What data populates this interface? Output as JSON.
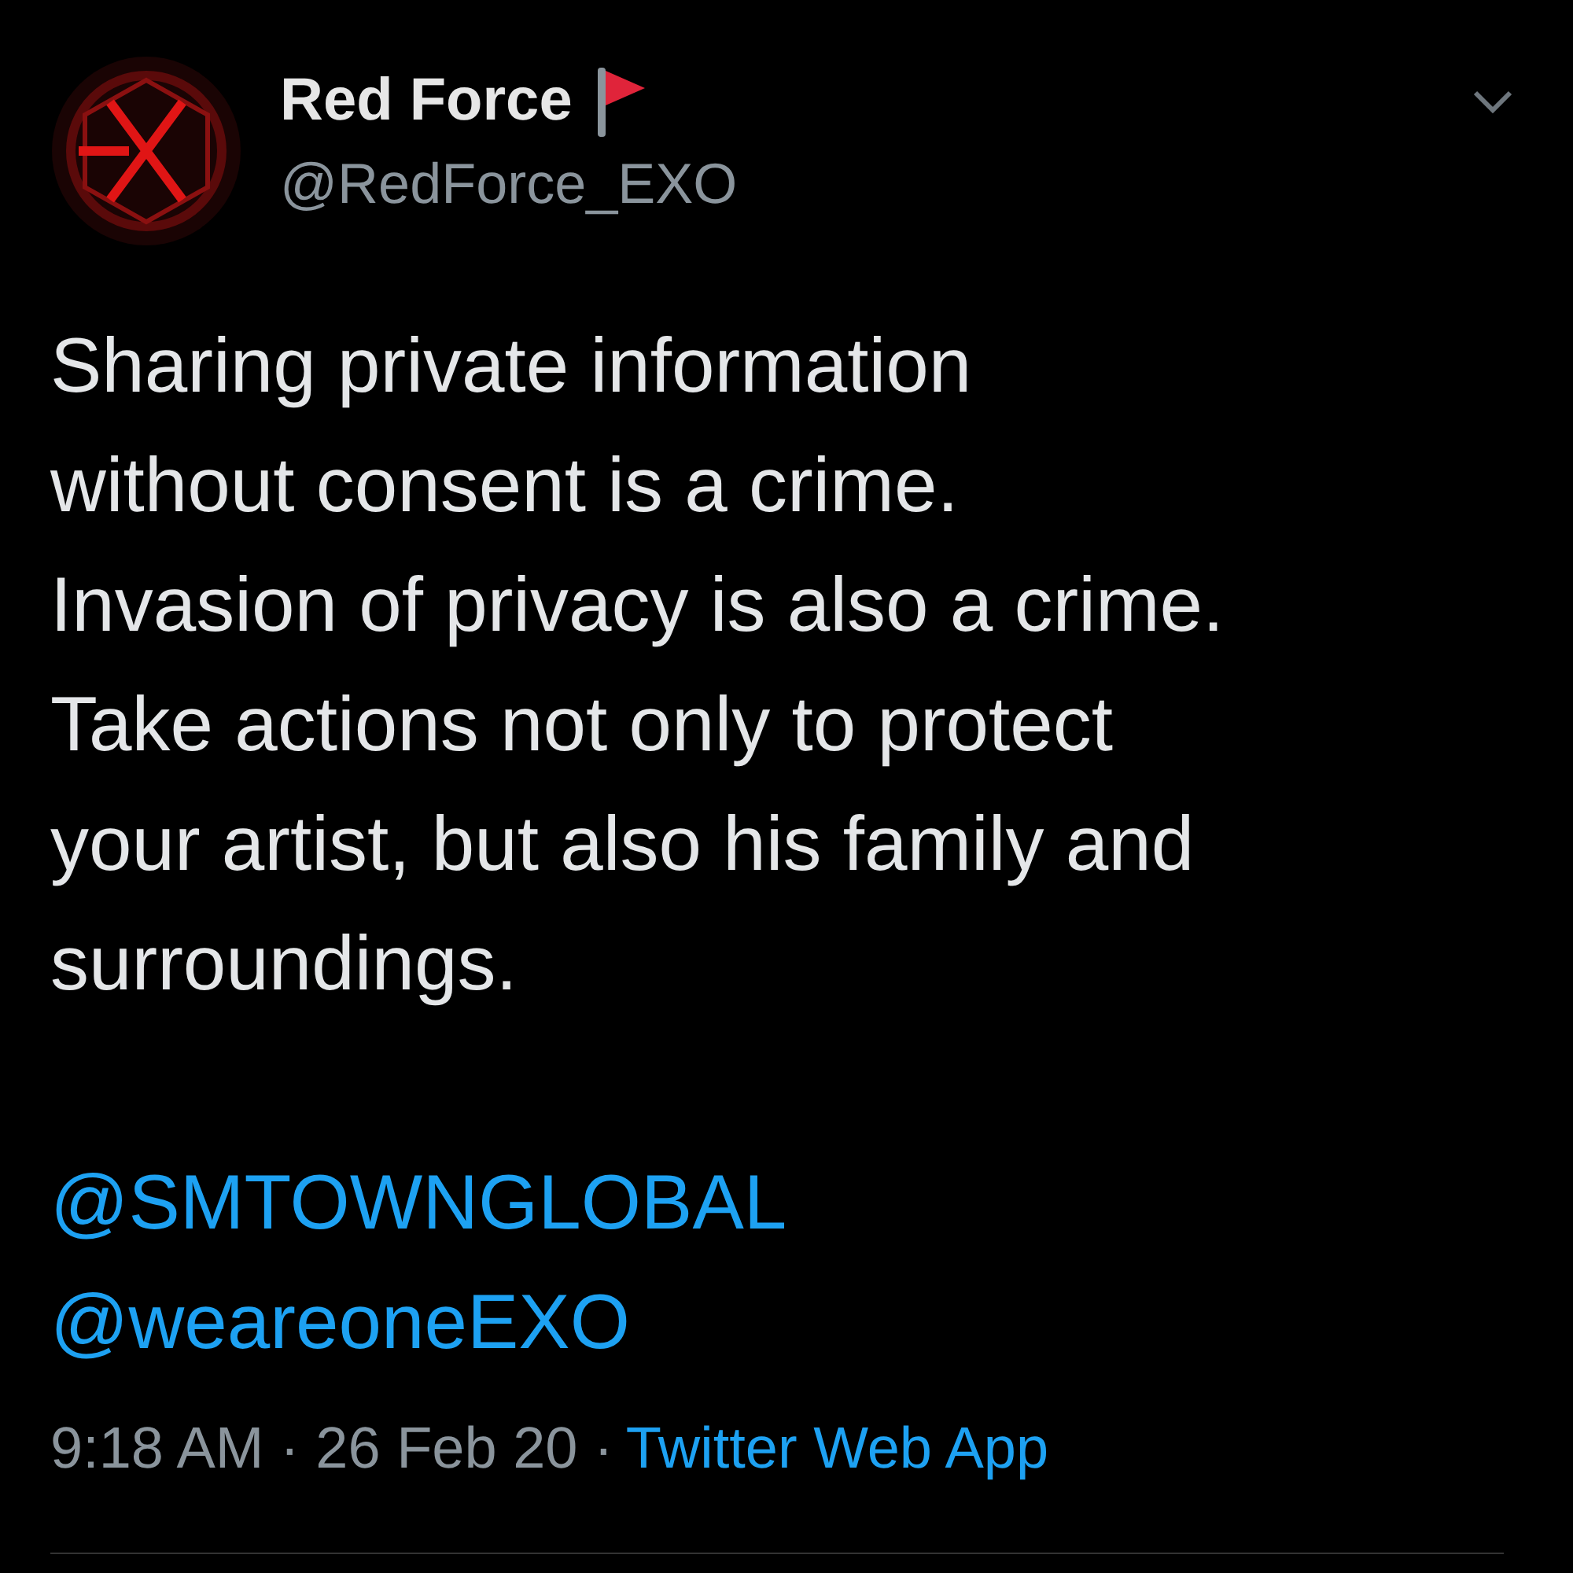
{
  "author": {
    "name": "Red Force",
    "handle": "@RedForce_EXO"
  },
  "body": "Sharing private information\nwithout consent is a crime.\nInvasion of privacy is also a crime.\nTake actions not only to protect\nyour artist, but also his family and\nsurroundings.",
  "mentions": [
    "@SMTOWNGLOBAL",
    "@weareoneEXO"
  ],
  "timestamp": "9:18 AM · 26 Feb 20 ·",
  "source": "Twitter Web App"
}
